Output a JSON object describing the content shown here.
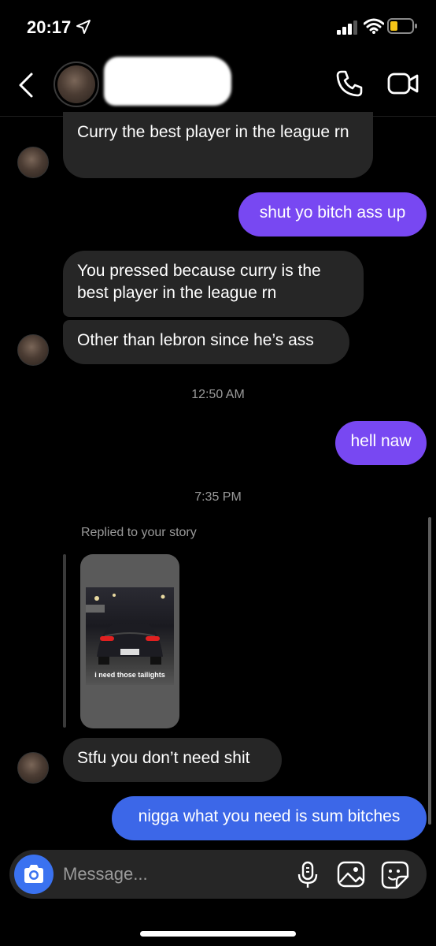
{
  "status_bar": {
    "time": "20:17"
  },
  "header": {
    "icons": [
      "back-icon",
      "phone-icon",
      "video-camera-icon"
    ]
  },
  "messages": [
    {
      "direction": "in",
      "text": "Curry the best player in the league rn"
    },
    {
      "direction": "out",
      "text": "shut yo bitch ass up"
    },
    {
      "direction": "in",
      "text": "You pressed because curry is the best player in the league rn"
    },
    {
      "direction": "in",
      "text": "Other than lebron since he’s ass"
    },
    {
      "type": "timestamp",
      "text": "12:50 AM"
    },
    {
      "direction": "out",
      "text": "hell naw"
    },
    {
      "type": "timestamp",
      "text": "7:35 PM"
    },
    {
      "type": "story_reply",
      "label": "Replied to your story",
      "story_caption": "i need those tailights"
    },
    {
      "direction": "in",
      "text": "Stfu you don’t need shit"
    },
    {
      "direction": "out",
      "text": "nigga what you need is sum bitches"
    }
  ],
  "composer": {
    "placeholder": "Message...",
    "icons": [
      "camera-icon",
      "microphone-icon",
      "gallery-icon",
      "sticker-icon"
    ]
  },
  "colors": {
    "background": "#000000",
    "incoming_bubble": "#262626",
    "outgoing_purple": "#7848f2",
    "outgoing_blue": "#3c67e8",
    "battery_low": "#f5c518"
  }
}
